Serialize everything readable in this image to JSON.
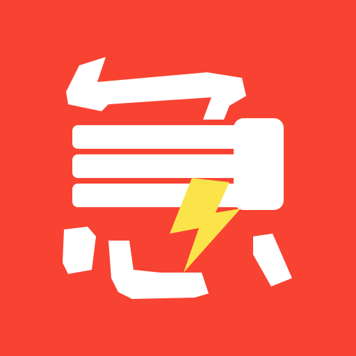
{
  "icon": {
    "glyph": "急",
    "name": "lightning-urgent-app-icon",
    "colors": {
      "background": "#f84332",
      "glyph": "#ffffff",
      "bolt": "#fbe44a"
    }
  }
}
